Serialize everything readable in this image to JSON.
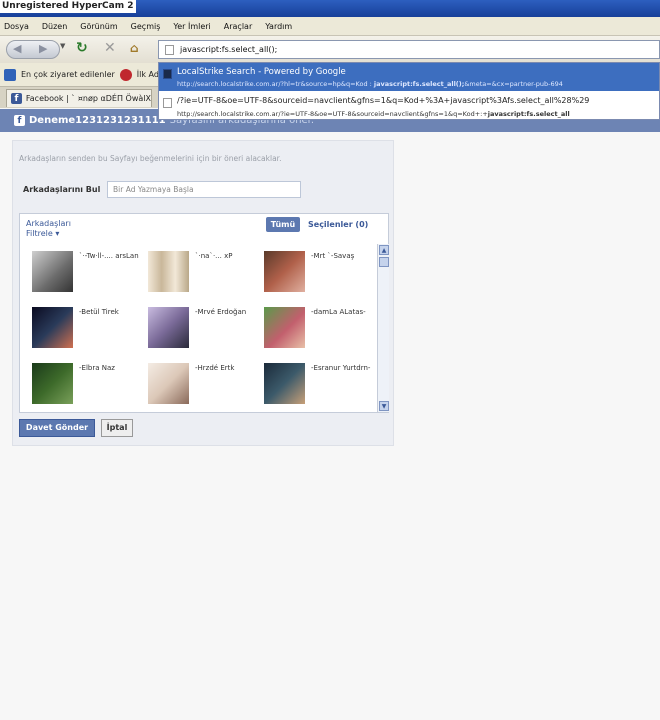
{
  "recorder_watermark": "Unregistered HyperCam 2",
  "menu": [
    "Dosya",
    "Düzen",
    "Görünüm",
    "Geçmiş",
    "Yer İmleri",
    "Araçlar",
    "Yardım"
  ],
  "url": "javascript:fs.select_all();",
  "autocomplete": [
    {
      "title": "LocalStrike Search - Powered by Google",
      "url_prefix": "http://search.localstrike.com.ar/?hl=tr&source=hp&q=Kod : ",
      "url_bold": "javascript:fs.select_all();",
      "url_suffix": "&meta=&cx=partner-pub-694"
    },
    {
      "title": "/?ie=UTF-8&oe=UTF-8&sourceid=navclient&gfns=1&q=Kod+%3A+javascript%3Afs.select_all%28%29",
      "url_prefix": "http://search.localstrike.com.ar/?ie=UTF-8&oe=UTF-8&sourceid=navclient&gfns=1&q=Kod+:+",
      "url_bold": "javascript:fs.select_all",
      "url_suffix": ""
    }
  ],
  "bookmarks": [
    "En çok ziyaret edilenler",
    "İlk Ad"
  ],
  "tab_label": "Facebook | `  ¤nøp αDÉΠ ÖwàlΧ",
  "fb": {
    "title": "Deneme1231231231111",
    "subtitle": "Sayfasını arkadaşlarına öner.",
    "intro": "Arkadaşların senden bu Sayfayı beğenmelerini için bir öneri alacaklar.",
    "search_label": "Arkadaşlarını Bul",
    "search_placeholder": "Bir Ad Yazmaya Başla",
    "filter": "Arkadaşları\nFiltrele ▾",
    "all_btn": "Tümü",
    "selected": "Seçilenler (0)",
    "friends": [
      {
        "name": "`·-Tw·ll-.... arsLan",
        "thumb": "#7d7d7d"
      },
      {
        "name": "`·na`·... xP",
        "thumb": "#d9c9b0"
      },
      {
        "name": "-Mrt `-Savaş",
        "thumb": "#b0604a"
      },
      {
        "name": "-Betül Tirek",
        "thumb": "#2a3b5a"
      },
      {
        "name": "-Mrvé Erdoğan",
        "thumb": "#9a8ab8"
      },
      {
        "name": "-damLa ALatas-",
        "thumb": "#c25f6d"
      },
      {
        "name": "-Elbra Naz",
        "thumb": "#3d6a2a"
      },
      {
        "name": "-Hrzdé Ertk",
        "thumb": "#dcc8b8"
      },
      {
        "name": "-Esranur Yurtdrn-",
        "thumb": "#3c5a6a"
      }
    ],
    "send_btn": "Davet Gönder",
    "cancel_btn": "İptal"
  }
}
